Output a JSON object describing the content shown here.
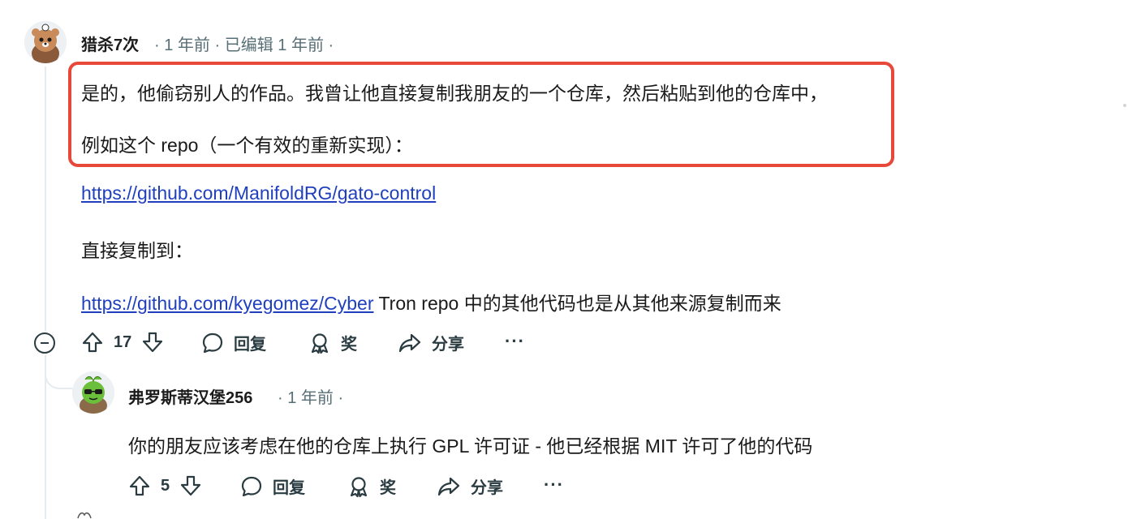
{
  "comment": {
    "username": "猎杀7次",
    "age": "1 年前",
    "edited": "已编辑 1 年前",
    "lines": [
      "是的，他偷窃别人的作品。我曾让他直接复制我朋友的一个仓库，然后粘贴到他的仓库中，",
      "例如这个 repo（一个有效的重新实现）："
    ],
    "link1": "https://github.com/ManifoldRG/gato-control",
    "copied_to": "直接复制到：",
    "link2": "https://github.com/kyegomez/Cyber",
    "link2_suffix": " Tron repo 中的其他代码也是从其他来源复制而来",
    "actions": {
      "votes": "17",
      "reply": "回复",
      "award": "奖",
      "share": "分享",
      "more": "···"
    }
  },
  "reply": {
    "username": "弗罗斯蒂汉堡256",
    "age": "1 年前",
    "text": "你的朋友应该考虑在他的仓库上执行 GPL 许可证 - 他已经根据 MIT 许可了他的代码",
    "actions": {
      "votes": "5",
      "reply": "回复",
      "award": "奖",
      "share": "分享",
      "more": "···"
    }
  },
  "colors": {
    "highlight": "#e8483a",
    "link": "#1f3fbf",
    "meta": "#576f76"
  }
}
